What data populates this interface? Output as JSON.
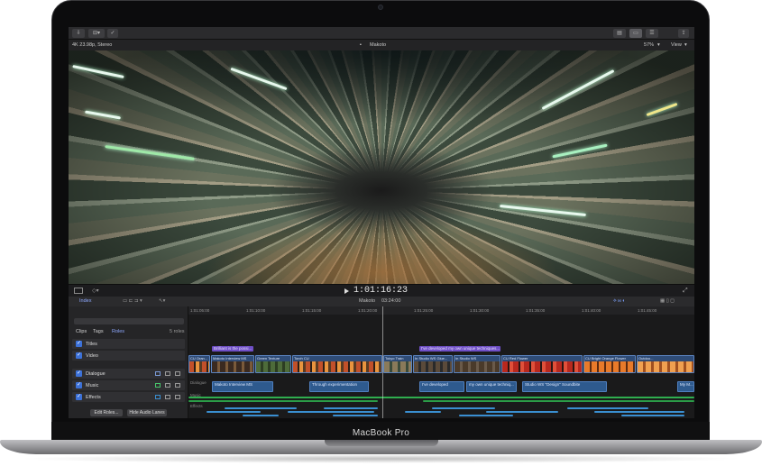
{
  "toolbar": {
    "format_label": "4K 23.98p, Stereo",
    "library_title": "Makoto",
    "zoom_level": "57%",
    "view_menu": "View"
  },
  "viewer": {
    "timecode": "1:01:16:23"
  },
  "timeline_header": {
    "index_tab": "Index",
    "project_name": "Makoto",
    "duration": "03:24:00"
  },
  "index": {
    "tabs": [
      "Clips",
      "Tags",
      "Roles"
    ],
    "roles_count": "5 roles",
    "roles": [
      {
        "label": "Titles"
      },
      {
        "label": "Video"
      },
      {
        "label": "Dialogue"
      },
      {
        "label": "Music"
      },
      {
        "label": "Effects"
      }
    ],
    "edit_roles_button": "Edit Roles...",
    "hide_audio_lanes_button": "Hide Audio Lanes"
  },
  "ruler": {
    "ticks": [
      "1:01:05:00",
      "1:01:10:00",
      "1:01:15:00",
      "1:01:20:00",
      "1:01:25:00",
      "1:01:30:00",
      "1:01:35:00",
      "1:01:40:00",
      "1:01:45:00"
    ]
  },
  "timeline": {
    "titles": [
      "Brilliant is the possi...",
      "I've developed my own unique techniques..."
    ],
    "video_clips": [
      "CU Oran...",
      "Makoto Interview MS",
      "Green Texture",
      "Torch CU",
      "Tokyo Train",
      "In Studio WS Glue...",
      "In Studio WS",
      "CU Red Flower",
      "CU Bright Orange Flower",
      "Outdoo..."
    ],
    "dialogue_clips": [
      "Makoto Interview MS",
      "Through experimentation",
      "I've developed",
      "my own unique techniq...",
      "Studio WS \"Design\" Soundbite",
      "My M..."
    ],
    "lane_labels": [
      "Dialogue",
      "Music",
      "Effects"
    ]
  },
  "device": {
    "model_label": "MacBook Pro"
  }
}
